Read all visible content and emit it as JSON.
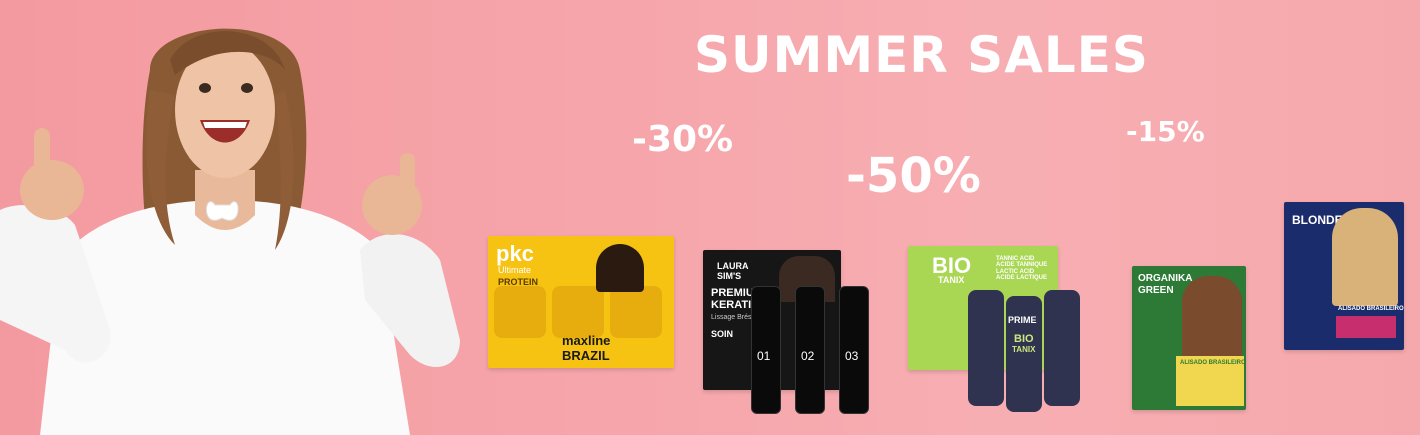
{
  "banner": {
    "headline": "SUMMER SALES",
    "discounts": [
      "-30%",
      "-50%",
      "-15%"
    ]
  },
  "products": {
    "pkc": {
      "brand": "pkc",
      "sub": "Ultimate",
      "line": "PROTEIN",
      "bottle_brand": "pkc",
      "bottle_line": "PROTEIN",
      "maxline": "maxline",
      "country": "BRAZIL"
    },
    "laura": {
      "brand_line1": "LAURA",
      "brand_line2": "SIM'S",
      "title1": "PREMIUM",
      "title2": "KERATI",
      "subtitle": "Lissage Brésil",
      "care": "SOIN",
      "bottle_labels": [
        "01",
        "02",
        "03"
      ]
    },
    "bio": {
      "brand": "BIO",
      "brand2": "TANIX",
      "bottle_brand": "PRIME",
      "bottle_line1": "BIO",
      "bottle_line2": "TANIX",
      "ingredients": "TANNIC ACID\nACIDE TANNIQUE\nLACTIC ACID\nACIDE LACTIQUE"
    },
    "organika": {
      "brand1": "ORGANIKA",
      "brand2": "GREEN",
      "product": "ALISADO BRASILEIRO"
    },
    "blonder": {
      "brand": "BLONDER",
      "product": "ALISADO BRASILEIRO"
    }
  },
  "colors": {
    "background": "#f6a6ab",
    "headline": "#ffffff"
  }
}
